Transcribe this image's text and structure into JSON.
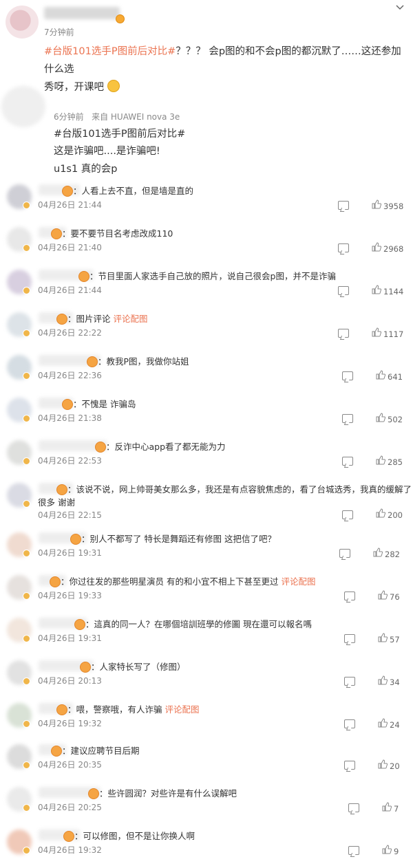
{
  "post": {
    "time": "7分钟前",
    "topic": "#台版101选手P图前后对比#",
    "text_after_topic": "？？？ 会p图的和不会p图的都沉默了……这还参加什么选",
    "text_line2": "秀呀，开课吧",
    "expand_icon": "chevron-down-icon"
  },
  "repost": {
    "time": "6分钟前",
    "source": "来自 HUAWEI nova 3e",
    "topic": "#台版101选手P图前后对比#",
    "line1": "这是诈骗吧....是诈骗吧!",
    "line2": "u1s1 真的会p"
  },
  "comments": [
    {
      "text": "人看上去不直，但是墙是直的",
      "link": "",
      "time": "04月26日 21:44",
      "likes": "3958"
    },
    {
      "text": "要不要节目名考虑改成110",
      "link": "",
      "time": "04月26日 21:40",
      "likes": "2968"
    },
    {
      "text": "节目里面人家选手自己放的照片，说自己很会p图，并不是诈骗",
      "link": "",
      "time": "04月26日 21:44",
      "likes": "1144"
    },
    {
      "text": "图片评论",
      "link": "评论配图",
      "time": "04月26日 22:22",
      "likes": "1117"
    },
    {
      "text": "教我P图，我做你站姐",
      "link": "",
      "time": "04月26日 22:36",
      "likes": "641"
    },
    {
      "text": "不愧是 诈骗岛",
      "link": "",
      "time": "04月26日 21:38",
      "likes": "502"
    },
    {
      "text": "反诈中心app看了都无能为力",
      "link": "",
      "time": "04月26日 22:53",
      "likes": "285"
    },
    {
      "text": "该说不说，网上帅哥美女那么多，我还是有点容貌焦虑的，看了台城选秀，我真的缓解了",
      "text2": "很多 谢谢",
      "link": "",
      "time": "04月26日 22:15",
      "likes": "200"
    },
    {
      "text": "别人不都写了 特长是舞蹈还有修图 这把信了吧？",
      "link": "",
      "time": "04月26日 19:31",
      "likes": "282"
    },
    {
      "text": "你过往发的那些明星演员 有的和小宜不相上下甚至更过",
      "link": "评论配图",
      "time": "04月26日 19:33",
      "likes": "76"
    },
    {
      "text": "這真的同一人？在哪個培訓班學的修圖 現在還可以報名嗎",
      "link": "",
      "time": "04月26日 19:31",
      "likes": "57"
    },
    {
      "text": "人家特长写了（修图）",
      "link": "",
      "time": "04月26日 20:13",
      "likes": "34"
    },
    {
      "text": "喂，警察哦，有人诈骗",
      "link": "评论配图",
      "time": "04月26日 19:32",
      "likes": "24"
    },
    {
      "text": "建议应聘节目后期",
      "link": "",
      "time": "04月26日 20:35",
      "likes": "20"
    },
    {
      "text": "些许圆润？对些许是有什么误解吧",
      "link": "",
      "time": "04月26日 20:25",
      "likes": "7"
    },
    {
      "text": "可以修图，但不是让你换人啊",
      "link": "",
      "time": "04月26日 19:32",
      "likes": "9"
    }
  ]
}
